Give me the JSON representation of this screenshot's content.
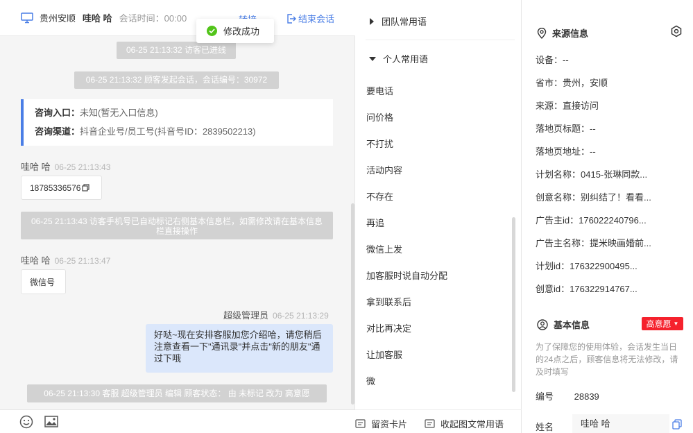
{
  "header": {
    "location": "贵州安顺",
    "visitor_name": "哇哈 哈",
    "session_time_label": "会话时间：00:00",
    "transfer_label": "转接",
    "end_label": "结束会话"
  },
  "toast": {
    "text": "修改成功"
  },
  "chat": {
    "sys_messages": [
      "06-25 21:13:32 访客已进线",
      "06-25 21:13:32 顾客发起会话，会话编号：30972",
      "06-25 21:13:43 访客手机号已自动标记右侧基本信息栏，如需修改请在基本信息栏直接操作",
      "06-25 21:13:30 客服 超级管理员 编辑 顾客状态： 由 未标记 改为 高意愿"
    ],
    "entry": {
      "k1": "咨询入口：",
      "v1": "未知(暂无入口信息)",
      "k2": "咨询渠道：",
      "v2": "抖音企业号/员工号(抖音号ID：2839502213)"
    },
    "msg1": {
      "sender": "哇哈 哈",
      "time": "06-25 21:13:43",
      "text": "18785336576"
    },
    "msg2": {
      "sender": "哇哈 哈",
      "time": "06-25 21:13:47",
      "text": "微信号"
    },
    "msg3": {
      "sender": "超级管理员",
      "time": "06-25 21:13:29",
      "text": "好哒~现在安排客服加您介绍哈，请您稍后注意查看一下\"通讯录\"并点击\"新的朋友\"通过下哦"
    }
  },
  "phrases": {
    "team_label": "团队常用语",
    "personal_label": "个人常用语",
    "items": [
      "要电话",
      "问价格",
      "不打扰",
      "活动内容",
      "不存在",
      "再追",
      "微信上发",
      "加客服时说自动分配",
      "拿到联系后",
      "对比再决定",
      "让加客服",
      "微"
    ],
    "footer": {
      "card_label": "留资卡片",
      "collapse_label": "收起图文常用语"
    }
  },
  "source": {
    "title": "来源信息",
    "rows": [
      "设备：--",
      "省市：贵州，安顺",
      "来源：直接访问",
      "落地页标题：--",
      "落地页地址：--",
      "计划名称：0415-张琳同款...",
      "创意名称：别纠结了！看看...",
      "广告主id：176022240796...",
      "广告主名称：提米映画婚前...",
      "计划id：176322900495...",
      "创意id：176322914767..."
    ]
  },
  "basic": {
    "title": "基本信息",
    "status_tag": "高意愿",
    "hint": "为了保障您的使用体验，会话发生当日的24点之后，顾客信息将无法修改，请及时填写",
    "id_label": "编号",
    "id_value": "28839",
    "name_label": "姓名",
    "name_value": "哇哈 哈"
  }
}
